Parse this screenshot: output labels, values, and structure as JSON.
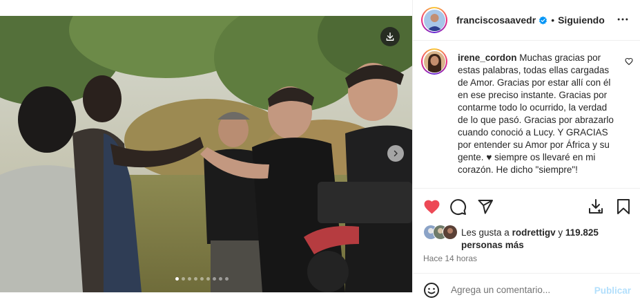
{
  "post": {
    "photo_alt": "Group of men shaking hands outdoors",
    "carousel_count": 9,
    "carousel_active": 0,
    "download_icon": "download-icon",
    "next_icon": "chevron-right-icon"
  },
  "header": {
    "username": "franciscosaavedr",
    "verified_icon": "verified-badge-icon",
    "separator": "•",
    "follow_label": "Siguiendo",
    "more_icon": "more-horizontal-icon"
  },
  "comment": {
    "username": "irene_cordon",
    "text_before_heart": "Muchas gracias por estas palabras, todas ellas cargadas de Amor. Gracias por estar allí con él en ese preciso instante. Gracias por contarme todo lo ocurrido, la verdad de lo que pasó. Gracias por abrazarlo cuando conoció a Lucy. Y GRACIAS por entender su Amor por África y su gente.",
    "heart_glyph": "♥",
    "text_after_heart": "siempre os llevaré en mi corazón. He dicho \"siempre\"!"
  },
  "actions": {
    "like_icon": "heart-filled-icon",
    "comment_icon": "comment-icon",
    "share_icon": "share-icon",
    "download_icon": "download-tray-icon",
    "save_icon": "bookmark-icon"
  },
  "likes": {
    "prefix": "Les gusta a",
    "user": "rodrettigv",
    "connector": "y",
    "count": "119.825",
    "suffix": "personas más"
  },
  "time": "Hace 14 horas",
  "add_comment": {
    "placeholder": "Agrega un comentario...",
    "publish_label": "Publicar",
    "emoji_icon": "emoji-icon"
  },
  "colors": {
    "like": "#ed4956",
    "verified": "#0095f6",
    "publish": "#b2dffc",
    "muted": "#737373"
  }
}
